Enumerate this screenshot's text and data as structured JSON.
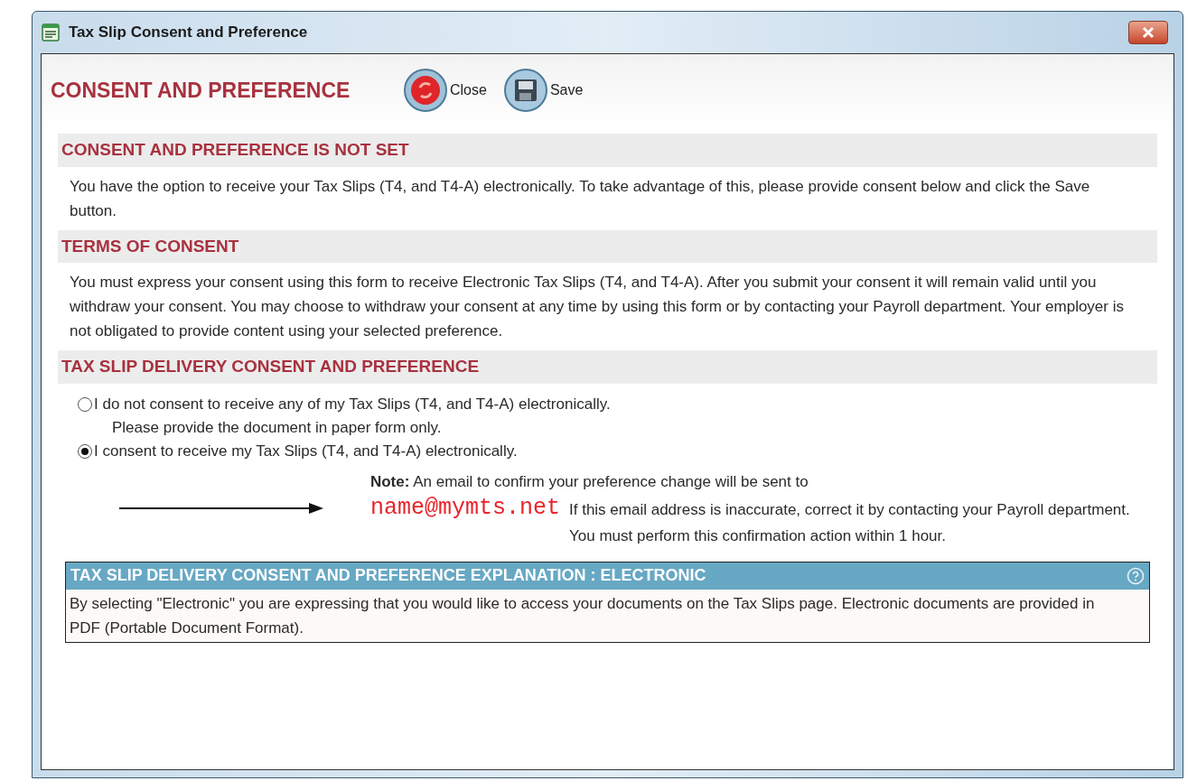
{
  "window": {
    "title": "Tax Slip Consent and Preference"
  },
  "header": {
    "title": "CONSENT AND PREFERENCE",
    "buttons": [
      {
        "kind": "close",
        "label": "Close"
      },
      {
        "kind": "save",
        "label": "Save"
      }
    ]
  },
  "sections": [
    {
      "heading": "CONSENT AND PREFERENCE IS NOT SET",
      "text": "You have the option to receive your Tax Slips (T4, and T4-A) electronically.  To take advantage of this, please provide consent below and click the Save button."
    },
    {
      "heading": "TERMS OF CONSENT",
      "text": "You must express your consent using this form to receive Electronic Tax Slips (T4, and T4-A).  After you submit your consent it will remain valid until you withdraw your consent.  You may choose to withdraw your consent at any time by using this form or by contacting your Payroll department.  Your employer is not obligated to provide content using your selected preference."
    }
  ],
  "delivery": {
    "heading": "TAX SLIP DELIVERY CONSENT AND PREFERENCE",
    "options": [
      {
        "label": "I do not consent to receive any of my Tax Slips (T4, and T4-A) electronically.",
        "detail": "Please provide the document in paper form only.",
        "selected": false
      },
      {
        "label": "I consent to receive my Tax Slips (T4, and T4-A) electronically.",
        "selected": true
      }
    ],
    "note": "**Note:** An email to confirm your preference change will be sent to",
    "email": "name@mymts.net",
    "note_rest": "If this email address is inaccurate, correct it by contacting your Payroll department.  You must perform this confirmation action within 1 hour."
  },
  "explanation": {
    "heading": "TAX SLIP DELIVERY CONSENT AND PREFERENCE EXPLANATION : ELECTRONIC",
    "text": "By selecting \"Electronic\" you are expressing that you would like to access your documents on the Tax Slips page.  Electronic documents are provided in PDF (Portable Document Format)."
  }
}
